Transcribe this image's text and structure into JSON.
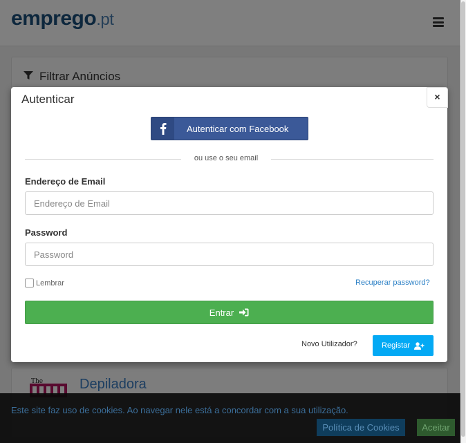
{
  "site": {
    "logo_main": "emprego",
    "logo_tld": ".pt"
  },
  "filter": {
    "title": "Filtrar Anúncios"
  },
  "listing": {
    "title": "Depiladora"
  },
  "modal": {
    "title": "Autenticar",
    "close_label": "×",
    "facebook_button": "Autenticar com Facebook",
    "divider_text": "ou use o seu email",
    "email_label": "Endereço de Email",
    "email_placeholder": "Endereço de Email",
    "email_value": "",
    "password_label": "Password",
    "password_placeholder": "Password",
    "password_value": "",
    "remember_label": "Lembrar",
    "remember_checked": false,
    "recover_link": "Recuperar password?",
    "enter_button": "Entrar",
    "new_user_text": "Novo Utilizador?",
    "register_button": "Registar"
  },
  "cookie": {
    "text": "Este site faz uso de cookies. Ao navegar nele está a concordar com a sua utilização.",
    "policy_button": "Política de Cookies",
    "accept_button": "Aceitar"
  },
  "colors": {
    "facebook": "#3b5998",
    "enter": "#4caf50",
    "register": "#03a9f4",
    "link": "#2a7fc5"
  },
  "icons": {
    "menu": "hamburger-icon",
    "filter": "funnel-icon",
    "facebook": "facebook-icon",
    "enter": "sign-in-icon",
    "register": "user-plus-icon"
  }
}
